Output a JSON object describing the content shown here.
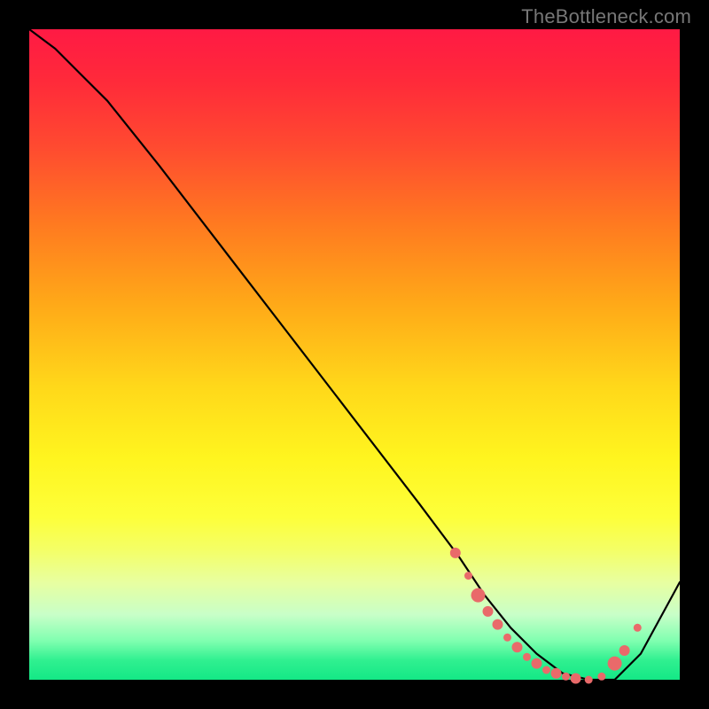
{
  "watermark": "TheBottleneck.com",
  "colors": {
    "background": "#000000",
    "curve": "#000000",
    "dots": "#e96a6a",
    "gradient_top": "#ff1a44",
    "gradient_bottom": "#14e886"
  },
  "chart_data": {
    "type": "line",
    "title": "",
    "xlabel": "",
    "ylabel": "",
    "xlim": [
      0,
      100
    ],
    "ylim": [
      0,
      100
    ],
    "series": [
      {
        "name": "bottleneck-curve",
        "x": [
          0,
          4,
          8,
          12,
          20,
          30,
          40,
          50,
          60,
          66,
          70,
          74,
          78,
          82,
          86,
          90,
          94,
          100
        ],
        "y": [
          100,
          97,
          93,
          89,
          79,
          66,
          53,
          40,
          27,
          19,
          13,
          8,
          4,
          1,
          0,
          0,
          4,
          15
        ]
      }
    ],
    "markers": [
      {
        "x": 65.5,
        "y": 19.5,
        "size": "md"
      },
      {
        "x": 67.5,
        "y": 16.0,
        "size": "sm"
      },
      {
        "x": 69.0,
        "y": 13.0,
        "size": "lg"
      },
      {
        "x": 70.5,
        "y": 10.5,
        "size": "md"
      },
      {
        "x": 72.0,
        "y": 8.5,
        "size": "md"
      },
      {
        "x": 73.5,
        "y": 6.5,
        "size": "sm"
      },
      {
        "x": 75.0,
        "y": 5.0,
        "size": "md"
      },
      {
        "x": 76.5,
        "y": 3.5,
        "size": "sm"
      },
      {
        "x": 78.0,
        "y": 2.5,
        "size": "md"
      },
      {
        "x": 79.5,
        "y": 1.5,
        "size": "sm"
      },
      {
        "x": 81.0,
        "y": 1.0,
        "size": "md"
      },
      {
        "x": 82.5,
        "y": 0.5,
        "size": "sm"
      },
      {
        "x": 84.0,
        "y": 0.2,
        "size": "md"
      },
      {
        "x": 86.0,
        "y": 0.0,
        "size": "sm"
      },
      {
        "x": 88.0,
        "y": 0.5,
        "size": "sm"
      },
      {
        "x": 90.0,
        "y": 2.5,
        "size": "lg"
      },
      {
        "x": 91.5,
        "y": 4.5,
        "size": "md"
      },
      {
        "x": 93.5,
        "y": 8.0,
        "size": "sm"
      }
    ]
  }
}
